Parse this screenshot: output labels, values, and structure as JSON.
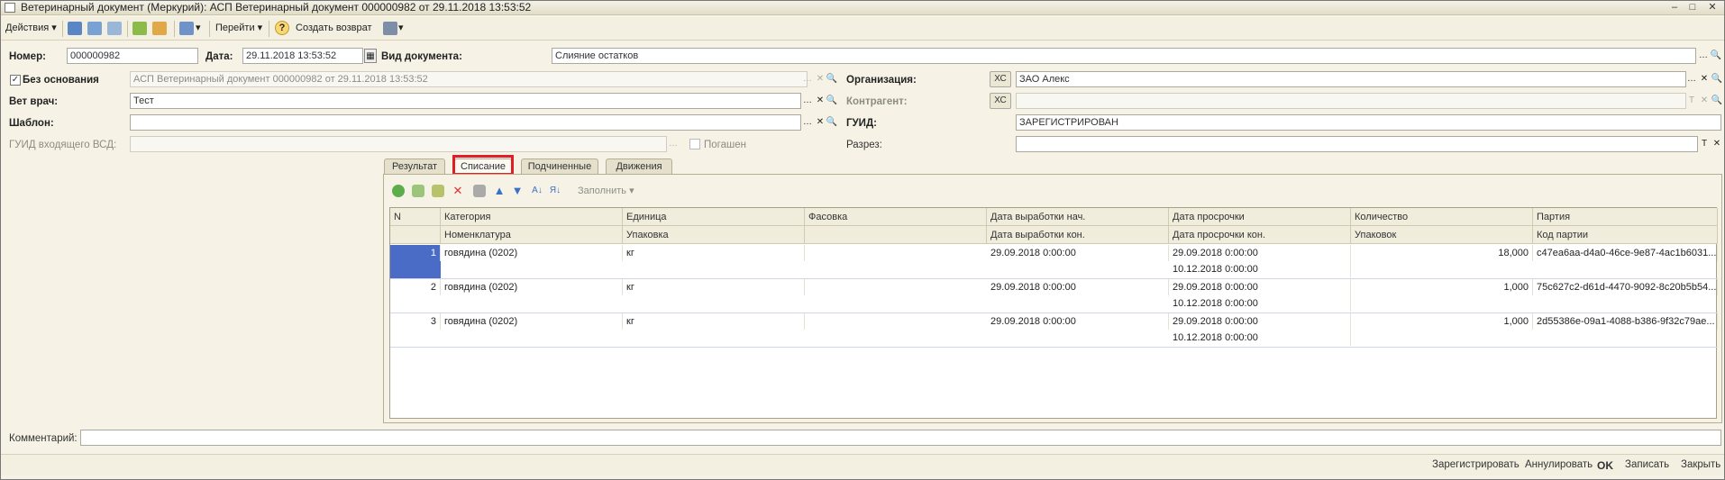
{
  "window": {
    "title": "Ветеринарный документ (Меркурий): АСП Ветеринарный документ 000000982 от 29.11.2018 13:53:52"
  },
  "toolbar": {
    "actions_label": "Действия",
    "goto_label": "Перейти",
    "create_return_label": "Создать возврат"
  },
  "form": {
    "number_label": "Номер:",
    "number_value": "000000982",
    "date_label": "Дата:",
    "date_value": "29.11.2018 13:53:52",
    "doc_type_label": "Вид документа:",
    "doc_type_value": "Слияние остатков",
    "no_basis_label": "Без основания",
    "basis_value": "АСП Ветеринарный документ 000000982 от 29.11.2018 13:53:52",
    "vet_label": "Вет врач:",
    "vet_value": "Тест",
    "template_label": "Шаблон:",
    "template_value": "",
    "guid_in_label": "ГУИД входящего ВСД:",
    "guid_in_value": "",
    "paid_label": "Погашен",
    "org_label": "Организация:",
    "org_xc": "ХС",
    "org_value": "ЗАО  Алекс",
    "contractor_label": "Контрагент:",
    "contractor_xc": "ХС",
    "contractor_value": "",
    "guid_label": "ГУИД:",
    "guid_value": "ЗАРЕГИСТРИРОВАН",
    "section_label": "Разрез:",
    "section_value": "",
    "comment_label": "Комментарий:",
    "comment_value": ""
  },
  "tabs": [
    "Результат",
    "Списание",
    "Подчиненные",
    "Движения"
  ],
  "panel_toolbar": {
    "fill_label": "Заполнить"
  },
  "table": {
    "header_top": [
      "N",
      "Категория",
      "Единица",
      "Фасовка",
      "Дата выработки нач.",
      "Дата просрочки",
      "Количество",
      "Партия"
    ],
    "header_bottom": [
      "",
      "Номенклатура",
      "Упаковка",
      "",
      "Дата выработки кон.",
      "Дата просрочки кон.",
      "Упаковок",
      "Код партии"
    ],
    "rows": [
      {
        "n": "1",
        "category": "говядина (0202)",
        "unit": "кг",
        "pack": "",
        "prod_start": "29.09.2018 0:00:00",
        "exp": "29.09.2018 0:00:00",
        "exp_end": "10.12.2018 0:00:00",
        "qty": "18,000",
        "batch": "c47ea6aa-d4a0-46ce-9e87-4ac1b6031..."
      },
      {
        "n": "2",
        "category": "говядина (0202)",
        "unit": "кг",
        "pack": "",
        "prod_start": "29.09.2018 0:00:00",
        "exp": "29.09.2018 0:00:00",
        "exp_end": "10.12.2018 0:00:00",
        "qty": "1,000",
        "batch": "75c627c2-d61d-4470-9092-8c20b5b54..."
      },
      {
        "n": "3",
        "category": "говядина (0202)",
        "unit": "кг",
        "pack": "",
        "prod_start": "29.09.2018 0:00:00",
        "exp": "29.09.2018 0:00:00",
        "exp_end": "10.12.2018 0:00:00",
        "qty": "1,000",
        "batch": "2d55386e-09a1-4088-b386-9f32c79ae..."
      }
    ]
  },
  "statusbar": {
    "register": "Зарегистрировать",
    "cancel": "Аннулировать",
    "ok": "OK",
    "save": "Записать",
    "close": "Закрыть"
  },
  "colors": {
    "highlight": "#e01e25",
    "selection": "#4a6bc6",
    "background": "#f6f3e6"
  }
}
